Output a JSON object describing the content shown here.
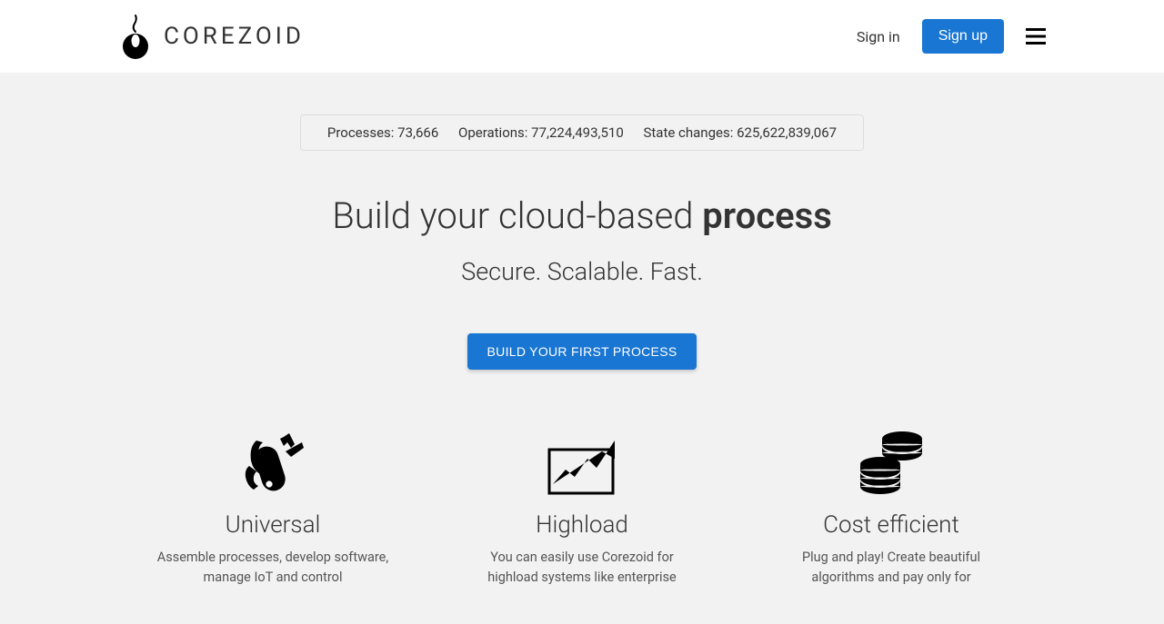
{
  "header": {
    "brand": "COREZOID",
    "signin": "Sign in",
    "signup": "Sign up"
  },
  "stats": {
    "processes_label": "Processes:",
    "processes_value": "73,666",
    "operations_label": "Operations:",
    "operations_value": "77,224,493,510",
    "state_changes_label": "State changes:",
    "state_changes_value": "625,622,839,067"
  },
  "hero": {
    "title_prefix": "Build your cloud-based ",
    "title_bold": "process",
    "subtitle": "Secure. Scalable. Fast.",
    "cta": "BUILD YOUR FIRST PROCESS"
  },
  "features": [
    {
      "title": "Universal",
      "desc": "Assemble processes, develop software, manage IoT and control"
    },
    {
      "title": "Highload",
      "desc": "You can easily use Corezoid for highload systems like enterprise"
    },
    {
      "title": "Cost efficient",
      "desc": "Plug and play! Create beautiful algorithms and pay only for"
    }
  ]
}
